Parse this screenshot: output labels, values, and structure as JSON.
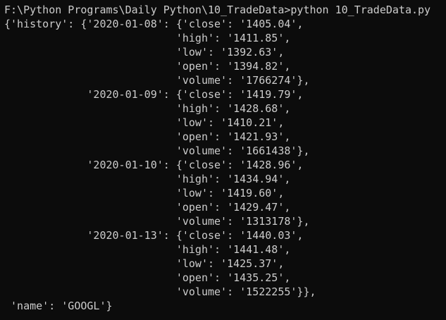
{
  "terminal": {
    "lines": [
      "F:\\Python Programs\\Daily Python\\10_TradeData>python 10_TradeData.py",
      "{'history': {'2020-01-08': {'close': '1405.04',",
      "                           'high': '1411.85',",
      "                           'low': '1392.63',",
      "                           'open': '1394.82',",
      "                           'volume': '1766274'},",
      "             '2020-01-09': {'close': '1419.79',",
      "                           'high': '1428.68',",
      "                           'low': '1410.21',",
      "                           'open': '1421.93',",
      "                           'volume': '1661438'},",
      "             '2020-01-10': {'close': '1428.96',",
      "                           'high': '1434.94',",
      "                           'low': '1419.60',",
      "                           'open': '1429.47',",
      "                           'volume': '1313178'},",
      "             '2020-01-13': {'close': '1440.03',",
      "                           'high': '1441.48',",
      "                           'low': '1425.37',",
      "                           'open': '1435.25',",
      "                           'volume': '1522255'}},",
      " 'name': 'GOOGL'}"
    ]
  },
  "colors": {
    "background": "#0c0c0c",
    "text": "#cccccc"
  }
}
